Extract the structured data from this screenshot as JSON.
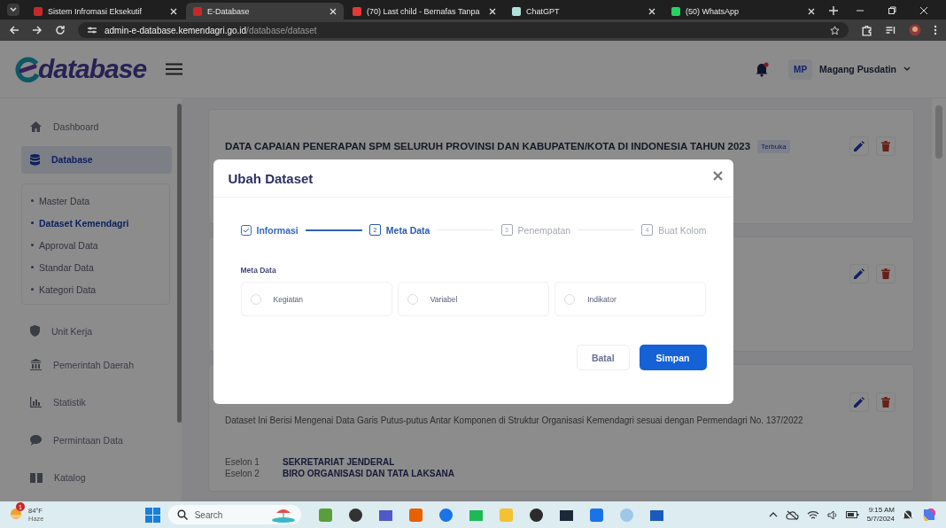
{
  "browser": {
    "tabs": [
      {
        "title": "Sistem Infromasi Eksekutif",
        "selected": false
      },
      {
        "title": "E-Database",
        "selected": true
      },
      {
        "title": "(70) Last child - Bernafas Tanpa",
        "selected": false
      },
      {
        "title": "ChatGPT",
        "selected": false
      },
      {
        "title": "(50) WhatsApp",
        "selected": false
      }
    ],
    "address": {
      "host": "admin-e-database.kemendagri.go.id",
      "path": "/database/dataset"
    }
  },
  "app": {
    "logo": "database",
    "notification": {
      "unread": true
    },
    "user": {
      "initials": "MP",
      "name": "Magang Pusdatin"
    },
    "sidebar": {
      "items": [
        {
          "label": "Dashboard",
          "kind": "home",
          "selected": false
        },
        {
          "label": "Database",
          "kind": "database",
          "selected": true,
          "children": [
            {
              "label": "Master Data",
              "selected": false
            },
            {
              "label": "Dataset Kemendagri",
              "selected": true
            },
            {
              "label": "Approval Data",
              "selected": false
            },
            {
              "label": "Standar Data",
              "selected": false
            },
            {
              "label": "Kategori Data",
              "selected": false
            }
          ]
        },
        {
          "label": "Unit Kerja",
          "kind": "shield",
          "selected": false
        },
        {
          "label": "Pemerintah Daerah",
          "kind": "bank",
          "selected": false
        },
        {
          "label": "Statistik",
          "kind": "chart",
          "selected": false
        },
        {
          "label": "Permintaan Data",
          "kind": "chat",
          "selected": false
        },
        {
          "label": "Katalog",
          "kind": "book",
          "selected": false
        }
      ]
    },
    "datasets": [
      {
        "title": "DATA CAPAIAN PENERAPAN SPM SELURUH PROVINSI DAN KABUPATEN/KOTA DI INDONESIA TAHUN 2023",
        "badge": "Terbuka",
        "editable": true
      },
      {
        "editable": true
      },
      {
        "description": "Dataset Ini Berisi Mengenai Data Garis Putus-putus Antar Komponen di Struktur Organisasi Kemendagri sesuai dengan Permendagri No. 137/2022",
        "editable": true,
        "fields": [
          {
            "label": "Eselon 1",
            "value": "SEKRETARIAT JENDERAL"
          },
          {
            "label": "Eselon 2",
            "value": "BIRO ORGANISASI DAN TATA LAKSANA"
          }
        ]
      }
    ]
  },
  "modal": {
    "title": "Ubah Dataset",
    "steps": [
      {
        "label": "Informasi",
        "completed": true,
        "selected": false
      },
      {
        "label": "Meta Data",
        "completed": false,
        "selected": true,
        "number": "2"
      },
      {
        "label": "Penempatan",
        "completed": false,
        "selected": false,
        "number": "3"
      },
      {
        "label": "Buat Kolom",
        "completed": false,
        "selected": false,
        "number": "4"
      }
    ],
    "field_label": "Meta Data",
    "options": [
      {
        "label": "Kegiatan",
        "selected": false
      },
      {
        "label": "Variabel",
        "selected": false
      },
      {
        "label": "Indikator",
        "selected": false
      }
    ],
    "buttons": [
      {
        "label": "Batal",
        "kind": "secondary"
      },
      {
        "label": "Simpan",
        "kind": "primary"
      }
    ]
  },
  "taskbar": {
    "weather": {
      "temp": "84°F",
      "condition": "Haze",
      "badge": "1"
    },
    "search": {
      "placeholder": "Search"
    },
    "clock": {
      "time": "9:15 AM",
      "date": "5/7/2024"
    }
  }
}
